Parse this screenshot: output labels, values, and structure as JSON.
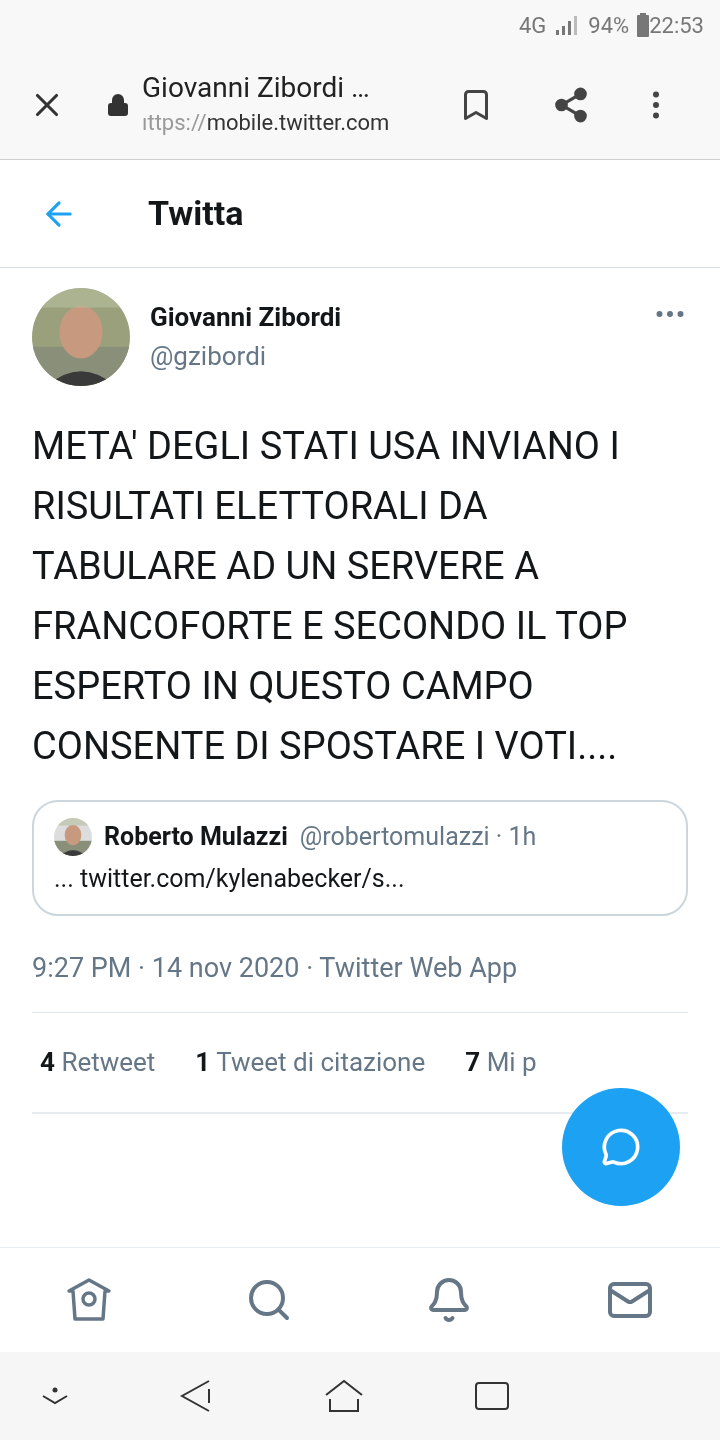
{
  "status_bar": {
    "network": "4G",
    "battery": "94%",
    "time": "22:53"
  },
  "browser": {
    "title": "Giovanni Zibordi …",
    "url_scheme": "ıttps://",
    "url_host": "mobile.twitter.com"
  },
  "header": {
    "title": "Twitta"
  },
  "tweet": {
    "name": "Giovanni Zibordi",
    "handle": "@gzibordi",
    "text": "META' DEGLI STATI USA INVIANO I RISULTATI ELETTORALI DA TABULARE AD UN SERVERE A FRANCOFORTE E SECONDO IL TOP ESPERTO IN QUESTO CAMPO CONSENTE DI SPOSTARE I VOTI....",
    "quote": {
      "name": "Roberto Mulazzi",
      "meta": "@robertomulazzi · 1h",
      "text": "... twitter.com/kylenabecker/s..."
    },
    "timestamp": "9:27 PM · 14 nov 2020 · Twitter Web App",
    "stats": [
      {
        "count": "4",
        "label": "Retweet"
      },
      {
        "count": "1",
        "label": "Tweet di citazione"
      },
      {
        "count": "7",
        "label": "Mi p"
      }
    ]
  }
}
